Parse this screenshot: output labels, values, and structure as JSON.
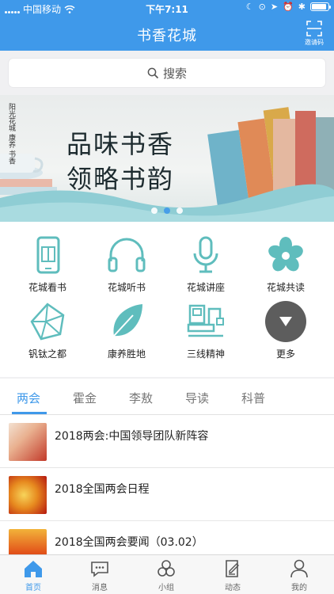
{
  "status_bar": {
    "carrier": "中国移动",
    "time": "下午7:11"
  },
  "nav": {
    "title": "书香花城",
    "invite_label": "邀请码"
  },
  "search": {
    "placeholder": "搜索"
  },
  "banner": {
    "line1": "品味书香",
    "line2": "领略书韵",
    "side_text": "阳光花城 康养 书香",
    "slide_count": 3,
    "active_slide": 2
  },
  "grid": [
    {
      "label": "花城看书",
      "icon": "phone-book-icon"
    },
    {
      "label": "花城听书",
      "icon": "headphones-icon"
    },
    {
      "label": "花城讲座",
      "icon": "microphone-icon"
    },
    {
      "label": "花城共读",
      "icon": "flower-icon"
    },
    {
      "label": "钒钛之都",
      "icon": "crystal-icon"
    },
    {
      "label": "康养胜地",
      "icon": "leaf-icon"
    },
    {
      "label": "三线精神",
      "icon": "machinery-icon"
    },
    {
      "label": "更多",
      "icon": "more-icon"
    }
  ],
  "tabs": [
    "两会",
    "霍金",
    "李敖",
    "导读",
    "科普"
  ],
  "active_tab": 0,
  "news": [
    {
      "title": "2018两会:中国领导团队新阵容"
    },
    {
      "title": "2018全国两会日程"
    },
    {
      "title": "2018全国两会要闻（03.02）"
    }
  ],
  "tabbar": [
    {
      "label": "首页",
      "icon": "home-icon"
    },
    {
      "label": "消息",
      "icon": "message-icon"
    },
    {
      "label": "小组",
      "icon": "group-icon"
    },
    {
      "label": "动态",
      "icon": "edit-icon"
    },
    {
      "label": "我的",
      "icon": "user-icon"
    }
  ],
  "colors": {
    "primary": "#3f99ea",
    "accent": "#5fbdbd",
    "more_button": "#5d5d5d"
  }
}
